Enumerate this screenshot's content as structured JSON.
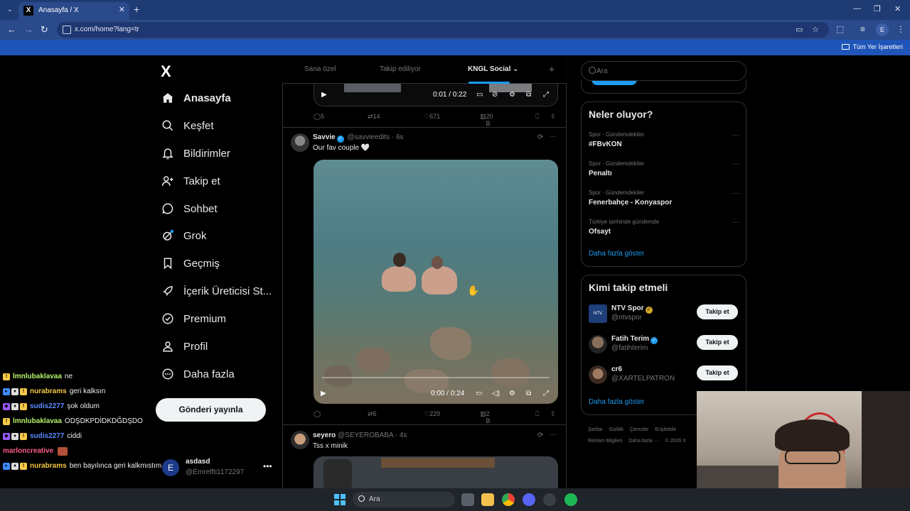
{
  "browser": {
    "tab_title": "Anasayfa / X",
    "tab_favicon": "X",
    "url": "x.com/home?lang=tr",
    "bookmarks_label": "Tüm Yer İşaretleri",
    "profile_initial": "E"
  },
  "x_logo": "X",
  "nav": {
    "items": [
      {
        "label": "Anasayfa",
        "icon": "home-icon"
      },
      {
        "label": "Keşfet",
        "icon": "search-icon"
      },
      {
        "label": "Bildirimler",
        "icon": "bell-icon"
      },
      {
        "label": "Takip et",
        "icon": "add-person-icon"
      },
      {
        "label": "Sohbet",
        "icon": "chat-icon"
      },
      {
        "label": "Grok",
        "icon": "grok-icon"
      },
      {
        "label": "Geçmiş",
        "icon": "bookmark-icon"
      },
      {
        "label": "İçerik Üreticisi St...",
        "icon": "rocket-icon"
      },
      {
        "label": "Premium",
        "icon": "verified-icon"
      },
      {
        "label": "Profil",
        "icon": "person-icon"
      },
      {
        "label": "Daha fazla",
        "icon": "more-circle-icon"
      }
    ],
    "post_button": "Gönderi yayınla"
  },
  "account": {
    "initial": "E",
    "name": "asdasd",
    "handle": "@Emrelfti1172297",
    "more": "•••"
  },
  "chat": [
    {
      "user": "lmnlubaklavaa",
      "message": "ne",
      "color": "#b6f36b"
    },
    {
      "user": "nurabrams",
      "message": "geri kalksın",
      "color": "#f7c948"
    },
    {
      "user": "sudis2277",
      "message": "şok oldum",
      "color": "#5b8cff"
    },
    {
      "user": "lmnlubaklavaa",
      "message": "ODŞDKPDİDKDĞDŞDO",
      "color": "#b6f36b"
    },
    {
      "user": "sudis2277",
      "message": "ciddi",
      "color": "#5b8cff"
    },
    {
      "user": "marloncreative",
      "message": "",
      "color": "#ff5c8a"
    },
    {
      "user": "nurabrams",
      "message": "ben bayılınca geri kalkmıstım",
      "color": "#f7c948"
    }
  ],
  "timeline": {
    "tabs": [
      "Sana özel",
      "Takip ediliyor",
      "KNGL Social"
    ],
    "active_tab": "KNGL Social",
    "prev_video": {
      "time": "0:01 / 0:22"
    },
    "prev_actions": {
      "replies": "5",
      "reposts": "14",
      "likes": "671",
      "views": "20 B"
    },
    "tweets": [
      {
        "name": "Savvie",
        "handle": "@savvieedits",
        "time": "6s",
        "text": "Our fav couple 🤍",
        "video_time": "0:00 / 0:24",
        "actions": {
          "replies": "",
          "reposts": "6",
          "likes": "229",
          "views": "2 B"
        }
      },
      {
        "name": "seyero",
        "handle": "@SEYEROBABA",
        "time": "4s",
        "text": "Tss x minik"
      }
    ]
  },
  "right": {
    "search_placeholder": "Ara",
    "trends_title": "Neler oluyor?",
    "trends": [
      {
        "meta": "Spor · Gündemdekiler",
        "name": "#FBvKON"
      },
      {
        "meta": "Spor · Gündemdekiler",
        "name": "Penaltı"
      },
      {
        "meta": "Spor · Gündemdekiler",
        "name": "Fenerbahçe - Konyaspor"
      },
      {
        "meta": "Türkiye tarihinde gündemde",
        "name": "Ofsayt"
      }
    ],
    "show_more": "Daha fazla göster",
    "follow_title": "Kimi takip etmeli",
    "follow": [
      {
        "name": "NTV Spor",
        "handle": "@ntvspor",
        "button": "Takip et",
        "badge": "gold"
      },
      {
        "name": "Fatih Terim",
        "handle": "@fatihterim",
        "button": "Takip et",
        "badge": "blue"
      },
      {
        "name": "cr6",
        "handle": "@XARTELPATRON",
        "button": "Takip et",
        "badge": ""
      }
    ],
    "footer": [
      "Şartlar",
      "Gizlilik",
      "Çerezler",
      "Erişilebilir",
      "Reklam Bilgileri",
      "Daha fazla ···",
      "© 2026 X"
    ]
  },
  "taskbar": {
    "search": "Ara"
  },
  "colors": {
    "accent": "#1d9bf0",
    "chrome": "#2a4a8c",
    "bookmarks": "#1f55b8"
  }
}
